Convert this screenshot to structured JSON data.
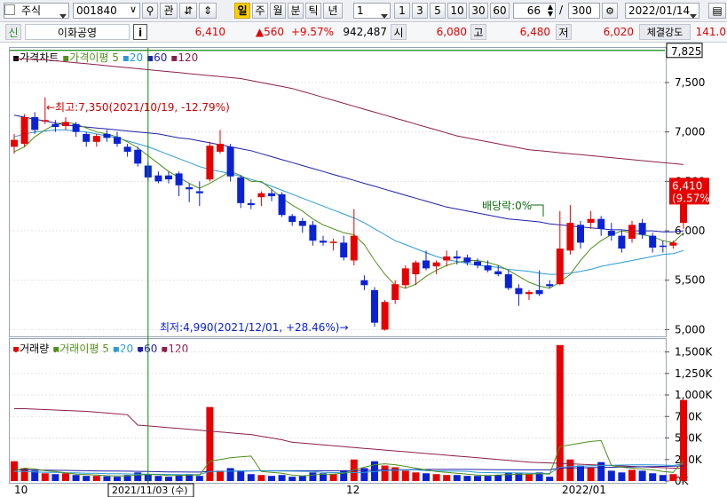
{
  "toolbar": {
    "market": "주식",
    "code": "001840",
    "btn_watch": "관",
    "period_buttons": [
      "일",
      "주",
      "월",
      "분",
      "틱",
      "년"
    ],
    "active_period": "일",
    "interval": "1",
    "num_buttons": [
      "1",
      "3",
      "5",
      "10",
      "30",
      "60"
    ],
    "count_value": "66",
    "count_sep": "/",
    "count_total": "300",
    "date": "2022/01/14"
  },
  "quote": {
    "tag": "신",
    "name": "이화공영",
    "info_btn": "i",
    "price": "6,410",
    "change": "▲560",
    "change_pct": "+9.57%",
    "volume": "942,487",
    "open_label": "시",
    "open": "6,080",
    "high_label": "고",
    "high": "6,480",
    "low_label": "저",
    "low": "6,020",
    "strength_label": "체결강도",
    "strength": "141.0"
  },
  "price_panel": {
    "title": "가격차트",
    "ma_label": "가격이평",
    "ma_periods": [
      "5",
      "20",
      "60",
      "120"
    ],
    "y_ticks": [
      "7,500",
      "7,000",
      "6,500",
      "6,000",
      "5,500",
      "5,000"
    ],
    "top_value": "7,825",
    "last_price": "6,410",
    "last_pct": "(9.57%)",
    "high_note": "←최고:7,350(2021/10/19, -12.79%)",
    "low_note": "최저:4,990(2021/12/01, +28.46%)→",
    "dividend_note": "배당락:0%"
  },
  "volume_panel": {
    "title": "거래량",
    "ma_label": "거래이평",
    "ma_periods": [
      "5",
      "20",
      "60",
      "120"
    ],
    "y_ticks": [
      "1,500K",
      "1,250K",
      "1,000K",
      "750K",
      "500K",
      "250K",
      "0K"
    ]
  },
  "x_axis": {
    "labels": [
      "10",
      "12",
      "2022/01"
    ],
    "cursor_date": "2021/11/03 (수)"
  },
  "colors": {
    "up": "#e60000",
    "down": "#0a22d6",
    "ma5": "#4f8f1a",
    "ma20": "#2b9ad6",
    "ma60": "#1f1fa8",
    "ma120": "#8b1f4a",
    "cursor": "#118811"
  },
  "chart_data": {
    "type": "candlestick",
    "price_range": [
      4950,
      7850
    ],
    "volume_range": [
      0,
      1650
    ],
    "candles": [
      {
        "o": 6850,
        "h": 6980,
        "l": 6780,
        "c": 6920
      },
      {
        "o": 6880,
        "h": 7180,
        "l": 6850,
        "c": 7150
      },
      {
        "o": 7150,
        "h": 7200,
        "l": 6980,
        "c": 7020
      },
      {
        "o": 7120,
        "h": 7350,
        "l": 7080,
        "c": 7120
      },
      {
        "o": 7080,
        "h": 7120,
        "l": 7000,
        "c": 7050
      },
      {
        "o": 7060,
        "h": 7150,
        "l": 7020,
        "c": 7100
      },
      {
        "o": 7080,
        "h": 7100,
        "l": 6950,
        "c": 7000
      },
      {
        "o": 6980,
        "h": 7000,
        "l": 6850,
        "c": 6900
      },
      {
        "o": 6900,
        "h": 6980,
        "l": 6850,
        "c": 6960
      },
      {
        "o": 6980,
        "h": 7020,
        "l": 6900,
        "c": 6940
      },
      {
        "o": 6950,
        "h": 7000,
        "l": 6850,
        "c": 6880
      },
      {
        "o": 6850,
        "h": 6880,
        "l": 6750,
        "c": 6800
      },
      {
        "o": 6820,
        "h": 6850,
        "l": 6650,
        "c": 6680
      },
      {
        "o": 6660,
        "h": 6700,
        "l": 6500,
        "c": 6540
      },
      {
        "o": 6560,
        "h": 6600,
        "l": 6480,
        "c": 6500
      },
      {
        "o": 6560,
        "h": 6600,
        "l": 6480,
        "c": 6520
      },
      {
        "o": 6580,
        "h": 6600,
        "l": 6350,
        "c": 6460
      },
      {
        "o": 6440,
        "h": 6480,
        "l": 6290,
        "c": 6420
      },
      {
        "o": 6400,
        "h": 6500,
        "l": 6250,
        "c": 6380
      },
      {
        "o": 6520,
        "h": 6900,
        "l": 6500,
        "c": 6860
      },
      {
        "o": 6800,
        "h": 7020,
        "l": 6780,
        "c": 6880
      },
      {
        "o": 6850,
        "h": 6880,
        "l": 6500,
        "c": 6550
      },
      {
        "o": 6540,
        "h": 6560,
        "l": 6230,
        "c": 6280
      },
      {
        "o": 6280,
        "h": 6320,
        "l": 6220,
        "c": 6260
      },
      {
        "o": 6340,
        "h": 6400,
        "l": 6250,
        "c": 6380
      },
      {
        "o": 6380,
        "h": 6420,
        "l": 6300,
        "c": 6350
      },
      {
        "o": 6370,
        "h": 6390,
        "l": 6140,
        "c": 6160
      },
      {
        "o": 6150,
        "h": 6170,
        "l": 6050,
        "c": 6090
      },
      {
        "o": 6100,
        "h": 6130,
        "l": 5980,
        "c": 6050
      },
      {
        "o": 6060,
        "h": 6100,
        "l": 5850,
        "c": 5900
      },
      {
        "o": 5900,
        "h": 5950,
        "l": 5850,
        "c": 5880
      },
      {
        "o": 5880,
        "h": 5920,
        "l": 5800,
        "c": 5890
      },
      {
        "o": 5880,
        "h": 5950,
        "l": 5700,
        "c": 5730
      },
      {
        "o": 5700,
        "h": 6220,
        "l": 5650,
        "c": 5950
      },
      {
        "o": 5500,
        "h": 5550,
        "l": 5400,
        "c": 5450
      },
      {
        "o": 5400,
        "h": 5430,
        "l": 5030,
        "c": 5070
      },
      {
        "o": 5000,
        "h": 5300,
        "l": 4990,
        "c": 5280
      },
      {
        "o": 5300,
        "h": 5500,
        "l": 5260,
        "c": 5460
      },
      {
        "o": 5450,
        "h": 5650,
        "l": 5420,
        "c": 5620
      },
      {
        "o": 5560,
        "h": 5700,
        "l": 5450,
        "c": 5680
      },
      {
        "o": 5700,
        "h": 5800,
        "l": 5600,
        "c": 5620
      },
      {
        "o": 5640,
        "h": 5700,
        "l": 5560,
        "c": 5680
      },
      {
        "o": 5700,
        "h": 5800,
        "l": 5640,
        "c": 5740
      },
      {
        "o": 5740,
        "h": 5800,
        "l": 5660,
        "c": 5720
      },
      {
        "o": 5730,
        "h": 5760,
        "l": 5650,
        "c": 5680
      },
      {
        "o": 5690,
        "h": 5720,
        "l": 5620,
        "c": 5650
      },
      {
        "o": 5650,
        "h": 5700,
        "l": 5580,
        "c": 5600
      },
      {
        "o": 5590,
        "h": 5650,
        "l": 5540,
        "c": 5560
      },
      {
        "o": 5560,
        "h": 5600,
        "l": 5400,
        "c": 5420
      },
      {
        "o": 5420,
        "h": 5460,
        "l": 5240,
        "c": 5360
      },
      {
        "o": 5360,
        "h": 5400,
        "l": 5300,
        "c": 5380
      },
      {
        "o": 5400,
        "h": 5600,
        "l": 5340,
        "c": 5360
      },
      {
        "o": 5460,
        "h": 5500,
        "l": 5420,
        "c": 5440
      },
      {
        "o": 5460,
        "h": 6200,
        "l": 5450,
        "c": 5820
      },
      {
        "o": 5800,
        "h": 6260,
        "l": 5760,
        "c": 6080
      },
      {
        "o": 6060,
        "h": 6100,
        "l": 5820,
        "c": 5880
      },
      {
        "o": 6080,
        "h": 6200,
        "l": 6020,
        "c": 6120
      },
      {
        "o": 6120,
        "h": 6150,
        "l": 5950,
        "c": 6020
      },
      {
        "o": 6000,
        "h": 6080,
        "l": 5900,
        "c": 5950
      },
      {
        "o": 5950,
        "h": 6000,
        "l": 5780,
        "c": 5820
      },
      {
        "o": 5920,
        "h": 6100,
        "l": 5880,
        "c": 6060
      },
      {
        "o": 6080,
        "h": 6120,
        "l": 5920,
        "c": 5960
      },
      {
        "o": 5950,
        "h": 5980,
        "l": 5780,
        "c": 5830
      },
      {
        "o": 5850,
        "h": 5900,
        "l": 5780,
        "c": 5840
      },
      {
        "o": 5850,
        "h": 5900,
        "l": 5820,
        "c": 5880
      },
      {
        "o": 6080,
        "h": 6480,
        "l": 6020,
        "c": 6410
      }
    ],
    "volume": [
      230,
      150,
      120,
      90,
      80,
      90,
      70,
      60,
      60,
      55,
      50,
      70,
      100,
      80,
      60,
      50,
      70,
      80,
      60,
      860,
      120,
      150,
      120,
      80,
      70,
      60,
      70,
      50,
      60,
      100,
      90,
      80,
      120,
      250,
      150,
      230,
      180,
      160,
      120,
      100,
      90,
      80,
      70,
      70,
      60,
      60,
      60,
      70,
      100,
      90,
      80,
      100,
      50,
      1580,
      250,
      180,
      160,
      220,
      120,
      100,
      130,
      120,
      90,
      70,
      80,
      942
    ],
    "ma5": [
      6800,
      6850,
      6950,
      7020,
      7080,
      7100,
      7080,
      7040,
      7000,
      6980,
      6950,
      6900,
      6840,
      6760,
      6680,
      6600,
      6540,
      6480,
      6430,
      6480,
      6540,
      6600,
      6560,
      6500,
      6500,
      6420,
      6330,
      6260,
      6200,
      6120,
      6060,
      6020,
      5980,
      5960,
      5860,
      5700,
      5560,
      5450,
      5420,
      5460,
      5540,
      5600,
      5650,
      5680,
      5700,
      5700,
      5680,
      5650,
      5600,
      5540,
      5480,
      5440,
      5420,
      5480,
      5560,
      5700,
      5820,
      5900,
      5960,
      6000,
      5980,
      5960,
      5940,
      5900,
      5880,
      5980
    ],
    "ma20": [
      6950,
      6980,
      7000,
      7010,
      7020,
      7020,
      7010,
      7000,
      6980,
      6960,
      6940,
      6910,
      6880,
      6850,
      6810,
      6770,
      6730,
      6690,
      6650,
      6620,
      6600,
      6580,
      6550,
      6520,
      6490,
      6450,
      6410,
      6370,
      6330,
      6290,
      6250,
      6210,
      6170,
      6130,
      6080,
      6020,
      5960,
      5900,
      5860,
      5820,
      5780,
      5740,
      5710,
      5690,
      5670,
      5650,
      5640,
      5630,
      5610,
      5600,
      5590,
      5570,
      5560,
      5560,
      5570,
      5590,
      5610,
      5640,
      5660,
      5680,
      5700,
      5720,
      5740,
      5760,
      5770,
      5800
    ],
    "ma60": [
      7170,
      7150,
      7130,
      7110,
      7090,
      7070,
      7060,
      7050,
      7040,
      7030,
      7020,
      7010,
      7000,
      6990,
      6980,
      6960,
      6940,
      6930,
      6910,
      6890,
      6870,
      6850,
      6830,
      6810,
      6780,
      6750,
      6720,
      6690,
      6660,
      6630,
      6600,
      6570,
      6540,
      6510,
      6480,
      6450,
      6420,
      6390,
      6360,
      6330,
      6300,
      6270,
      6240,
      6220,
      6200,
      6180,
      6160,
      6140,
      6120,
      6110,
      6100,
      6090,
      6070,
      6060,
      6050,
      6040,
      6030,
      6020,
      6010,
      6010,
      6000,
      6000,
      6000,
      5990,
      5990,
      6000
    ],
    "ma120": [
      7740,
      7740,
      7730,
      7730,
      7720,
      7710,
      7700,
      7690,
      7680,
      7670,
      7660,
      7650,
      7640,
      7630,
      7620,
      7610,
      7600,
      7590,
      7580,
      7570,
      7560,
      7550,
      7540,
      7520,
      7500,
      7480,
      7460,
      7440,
      7410,
      7380,
      7350,
      7320,
      7290,
      7260,
      7230,
      7200,
      7170,
      7140,
      7110,
      7080,
      7050,
      7020,
      6990,
      6960,
      6940,
      6920,
      6900,
      6880,
      6860,
      6840,
      6820,
      6810,
      6800,
      6790,
      6780,
      6770,
      6760,
      6750,
      6740,
      6730,
      6720,
      6710,
      6700,
      6690,
      6680,
      6670
    ],
    "vma5": [
      120,
      150,
      140,
      120,
      110,
      95,
      80,
      75,
      70,
      62,
      60,
      60,
      70,
      75,
      75,
      65,
      65,
      70,
      70,
      230,
      250,
      270,
      280,
      290,
      110,
      100,
      90,
      70,
      60,
      70,
      80,
      80,
      90,
      130,
      160,
      190,
      200,
      190,
      170,
      150,
      130,
      110,
      100,
      90,
      80,
      70,
      65,
      70,
      75,
      80,
      80,
      85,
      80,
      400,
      420,
      440,
      460,
      470,
      180,
      160,
      150,
      140,
      130,
      110,
      100,
      240
    ],
    "vma20": [
      110,
      110,
      105,
      100,
      100,
      95,
      95,
      90,
      90,
      85,
      85,
      82,
      80,
      80,
      78,
      76,
      75,
      74,
      74,
      110,
      112,
      114,
      116,
      118,
      120,
      118,
      116,
      114,
      112,
      110,
      100,
      98,
      96,
      98,
      100,
      110,
      120,
      125,
      128,
      130,
      120,
      118,
      116,
      114,
      112,
      100,
      98,
      96,
      95,
      94,
      92,
      90,
      88,
      160,
      168,
      172,
      176,
      180,
      184,
      186,
      188,
      190,
      188,
      186,
      180,
      200
    ],
    "vma60": [
      130,
      130,
      128,
      126,
      125,
      124,
      122,
      120,
      118,
      116,
      115,
      114,
      112,
      110,
      108,
      106,
      105,
      104,
      104,
      110,
      112,
      114,
      116,
      118,
      120,
      120,
      120,
      120,
      120,
      120,
      120,
      120,
      120,
      122,
      124,
      126,
      128,
      130,
      132,
      134,
      135,
      135,
      135,
      135,
      135,
      134,
      133,
      132,
      131,
      130,
      130,
      130,
      130,
      150,
      152,
      154,
      156,
      158,
      160,
      162,
      164,
      166,
      168,
      170,
      172,
      175
    ],
    "vma120": [
      840,
      840,
      835,
      830,
      825,
      820,
      815,
      810,
      800,
      790,
      780,
      770,
      650,
      640,
      630,
      620,
      610,
      600,
      590,
      580,
      570,
      560,
      550,
      540,
      520,
      500,
      480,
      450,
      440,
      430,
      420,
      410,
      400,
      390,
      380,
      370,
      360,
      350,
      340,
      330,
      320,
      310,
      300,
      290,
      280,
      270,
      260,
      250,
      240,
      230,
      220,
      215,
      210,
      205,
      200,
      195,
      190,
      185,
      180,
      175,
      170,
      165,
      160,
      155,
      150,
      148
    ]
  }
}
